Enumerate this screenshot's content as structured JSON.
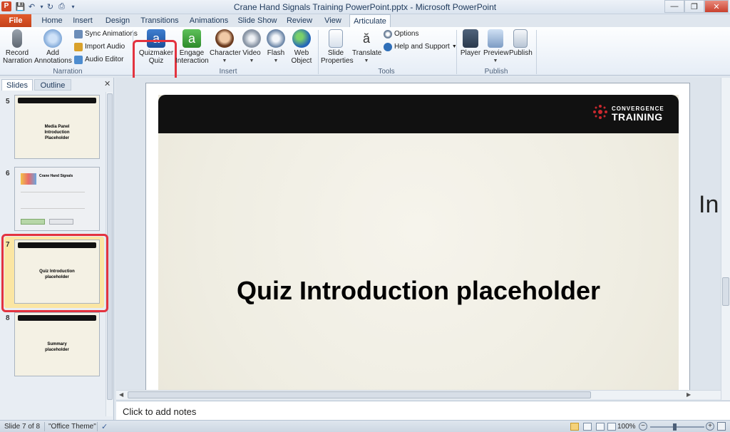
{
  "window": {
    "title": "Crane Hand Signals Training PowerPoint.pptx - Microsoft PowerPoint",
    "app_icon_letter": "P"
  },
  "tabs": [
    "File",
    "Home",
    "Insert",
    "Design",
    "Transitions",
    "Animations",
    "Slide Show",
    "Review",
    "View",
    "Articulate"
  ],
  "ribbon": {
    "narration": {
      "label": "Narration",
      "record": "Record Narration",
      "add_annotations": "Add Annotations",
      "sync_animations": "Sync Animations",
      "import_audio": "Import Audio",
      "audio_editor": "Audio Editor"
    },
    "insert": {
      "label": "Insert",
      "quizmaker": "Quizmaker Quiz",
      "engage": "Engage Interaction",
      "character": "Character",
      "video": "Video",
      "flash": "Flash",
      "web_object": "Web Object"
    },
    "tools": {
      "label": "Tools",
      "slide_properties": "Slide Properties",
      "translate": "Translate",
      "options": "Options",
      "help": "Help and Support"
    },
    "publish": {
      "label": "Publish",
      "player": "Player",
      "preview": "Preview",
      "publish": "Publish"
    }
  },
  "slides_pane": {
    "tab_slides": "Slides",
    "tab_outline": "Outline",
    "thumbnails": [
      {
        "num": "5",
        "text": "Media Panel Introduction Placeholder"
      },
      {
        "num": "6",
        "text": "Crane Hand Signals"
      },
      {
        "num": "7",
        "text": "Quiz Introduction placeholder"
      },
      {
        "num": "8",
        "text": "Summary placeholder"
      }
    ]
  },
  "slide": {
    "logo_top": "CONVERGENCE",
    "logo_bottom": "TRAINING",
    "title": "Quiz Introduction placeholder",
    "offslide_text": "In"
  },
  "notes": {
    "placeholder": "Click to add notes"
  },
  "status": {
    "slide_of": "Slide 7 of 8",
    "theme": "\"Office Theme\"",
    "zoom": "100%"
  },
  "colors": {
    "file_tab": "#d24726",
    "highlight": "#e3333f",
    "slide_bar": "#111111"
  }
}
